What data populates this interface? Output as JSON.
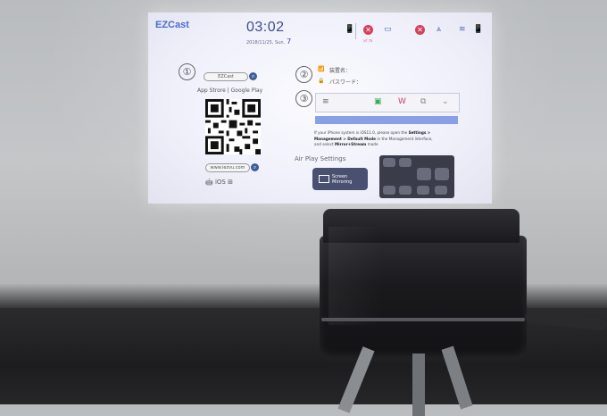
{
  "screen": {
    "logo": "EZCast",
    "logo_sub": "",
    "time": "03:02",
    "date": "2018/11/25, Sun.",
    "date_day": "7",
    "status_label": "ｼｸﾞﾅﾙ",
    "step1_number": "①",
    "step1_field": "EZCast",
    "stores": "App Strore | Google Play",
    "url_field": "www.iezvu.com",
    "os_logos": "🤖 iOS ⊞ ",
    "step2_number": "②",
    "device_name_label": "装置名：",
    "password_label": "パスワード：",
    "step3_number": "③",
    "info_line1": "If your iPhone system is iOS11.0, please open the",
    "info_settings": "Settings >",
    "info_line2": "Management > Default Mode",
    "info_line2b": "in the Management interface,",
    "info_line3": "and select",
    "info_mirror": "Mirror+Stream",
    "info_line3b": "mode",
    "airplay": "Air Play Settings",
    "screen_mirroring": "Screen Mirroring"
  },
  "projector": {
    "brand": ""
  },
  "colors": {
    "accent": "#3e4a8f",
    "alert": "#d8405a",
    "bar": "#8aa0e6"
  }
}
